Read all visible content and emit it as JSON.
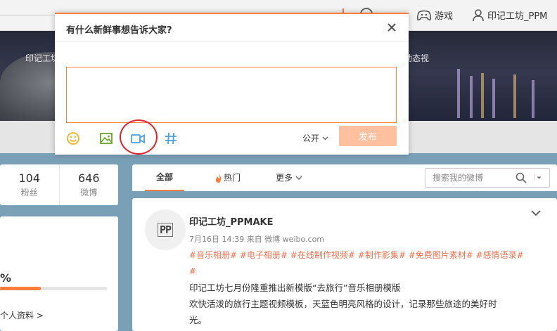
{
  "header": {
    "game_label": "游戏",
    "user_label": "印记工坊_PPM"
  },
  "cover": {
    "text_left": "印记工坊",
    "text_right": "动态视"
  },
  "stats": {
    "fans_count": "104",
    "fans_label": "粉丝",
    "posts_count": "646",
    "posts_label": "微博"
  },
  "profile": {
    "percent_text": "%",
    "completion_fraction": 0.38,
    "more_label": "个人资料 >"
  },
  "feed_tabs": {
    "all": "全部",
    "hot": "热门",
    "more": "更多",
    "search_placeholder": "搜索我的微博"
  },
  "post": {
    "author": "印记工坊_PPMAKE",
    "meta": "7月16日 14:39 来自 微博 weibo.com",
    "tags": "#音乐相册# #电子相册# #在线制作视频# #制作影集# #免费图片素材# #感情语录#",
    "tags_tail": "#",
    "line1": "印记工坊七月份隆重推出新模版“去旅行”音乐相册模版",
    "line2": "欢快活泼的旅行主题视频模板，天蓝色明亮风格的设计，记录那些旅途的美好时",
    "line3": "光。",
    "avatar_text": "PP"
  },
  "dialog": {
    "title": "有什么新鲜事想告诉大家?",
    "text_value": "",
    "privacy_label": "公开",
    "publish_label": "发布"
  },
  "colors": {
    "accent": "#fa7d3c",
    "publish_disabled": "#ffc09f",
    "highlight_ring": "#e0242d",
    "tag_color": "#eb7350"
  },
  "icons": {
    "emoji": "smile-icon",
    "image": "image-icon",
    "video": "video-icon",
    "topic": "hash-icon",
    "close": "close-icon"
  }
}
